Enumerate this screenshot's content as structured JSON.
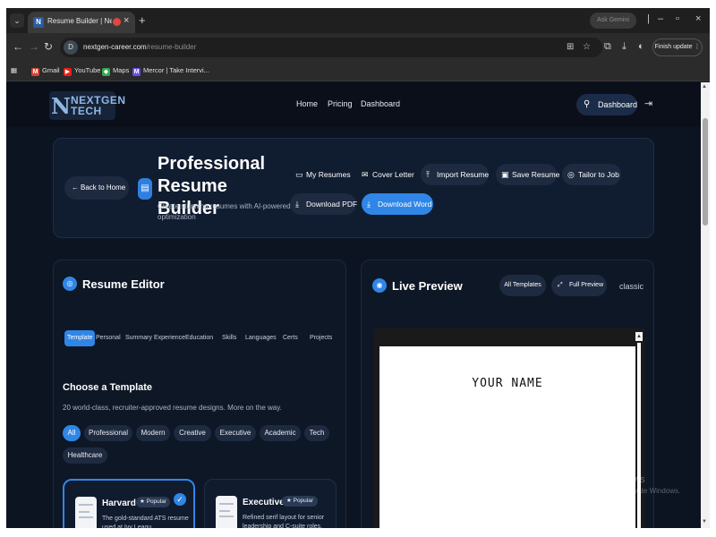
{
  "browser": {
    "tab_title": "Resume Builder | NextGen",
    "url_host": "nextgen-career.com",
    "url_path": "/resume-builder",
    "ask_gemini": "Ask Gemini",
    "finish_update": "Finish update",
    "bookmarks": [
      "Gmail",
      "YouTube",
      "Maps",
      "Mercor | Take Intervi..."
    ]
  },
  "site": {
    "logo_line1": "NEXTGEN",
    "logo_line2": "TECH",
    "nav": [
      "Home",
      "Pricing",
      "Dashboard"
    ],
    "dashboard_button": "Dashboard"
  },
  "header": {
    "back_button": "Back to Home",
    "title": "Professional Resume Builder",
    "subtitle": "Create stunning resumes with AI-powered optimization",
    "buttons": {
      "my_resumes": "My Resumes",
      "cover_letter": "Cover Letter",
      "import_resume": "Import Resume",
      "save_resume": "Save Resume",
      "tailor_to_job": "Tailor to Job",
      "download_pdf": "Download PDF",
      "download_word": "Download Word"
    }
  },
  "editor": {
    "title": "Resume Editor",
    "tabs": [
      "Template",
      "Personal",
      "Summary",
      "Experience",
      "Education",
      "Skills",
      "Languages",
      "Certs",
      "Projects"
    ],
    "active_tab": "Template",
    "choose_title": "Choose a Template",
    "choose_desc": "20 world-class, recruiter-approved resume designs. More on the way.",
    "filters": [
      "All",
      "Professional",
      "Modern",
      "Creative",
      "Executive",
      "Academic",
      "Tech",
      "Healthcare"
    ],
    "active_filter": "All",
    "templates": [
      {
        "name": "Harvard",
        "badge": "Popular",
        "desc": "The gold-standard ATS resume used at Ivy Leagu...",
        "selected": true
      },
      {
        "name": "Executive",
        "badge": "Popular",
        "desc": "Refined serif layout for senior leadership and C-suite roles.",
        "selected": false
      }
    ]
  },
  "preview": {
    "title": "Live Preview",
    "all_templates": "All Templates",
    "full_preview": "Full Preview",
    "current_template": "classic",
    "placeholder_name": "YOUR NAME"
  },
  "watermark": {
    "line1": "Activate Windows",
    "line2": "Go to Settings to activate Windows."
  },
  "colors": {
    "page_bg": "#0c1422",
    "card_bg": "#0e1726",
    "accent": "#2f86e6",
    "pill_bg": "#1d2a40"
  }
}
